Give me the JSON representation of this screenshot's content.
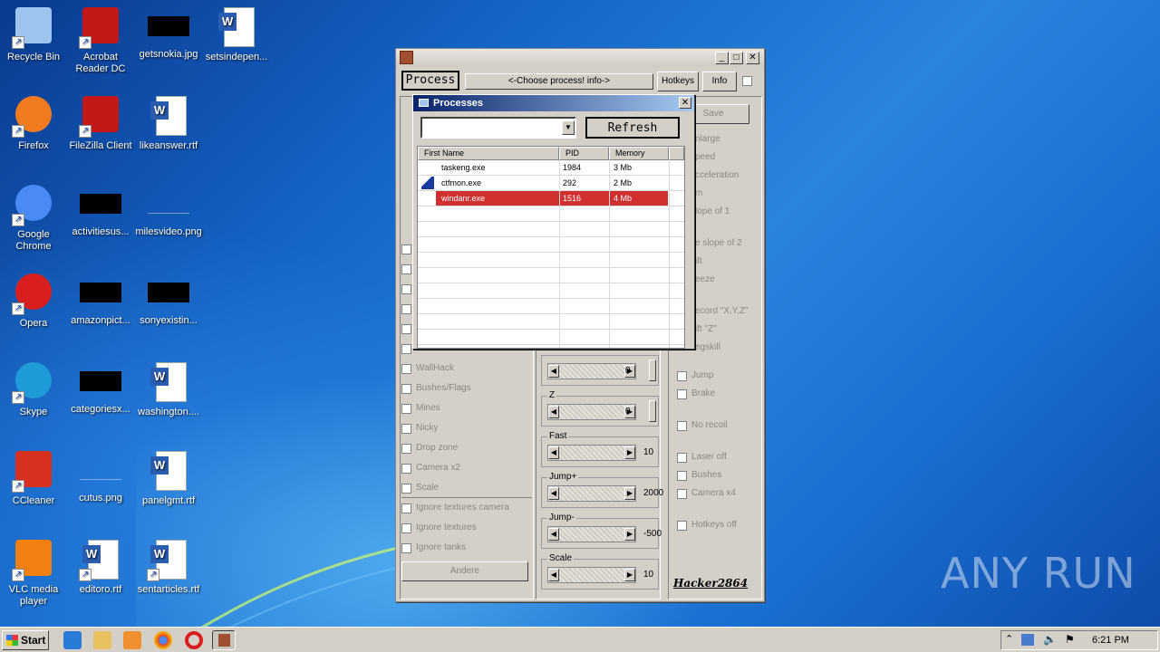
{
  "desktop": {
    "icons": [
      {
        "label": "Recycle Bin",
        "icon": "recycle-bin-icon"
      },
      {
        "label": "Acrobat Reader DC",
        "icon": "acrobat-icon"
      },
      {
        "label": "getsnokia.jpg",
        "icon": "image-thumb-icon"
      },
      {
        "label": "setsindepen...",
        "icon": "word-doc-icon"
      },
      {
        "label": "Firefox",
        "icon": "firefox-icon"
      },
      {
        "label": "FileZilla Client",
        "icon": "filezilla-icon"
      },
      {
        "label": "likeanswer.rtf",
        "icon": "word-doc-icon"
      },
      {
        "label": "Google Chrome",
        "icon": "chrome-icon"
      },
      {
        "label": "activitiesus...",
        "icon": "image-thumb-icon"
      },
      {
        "label": "milesvideo.png",
        "icon": "image-thumb-icon"
      },
      {
        "label": "Opera",
        "icon": "opera-icon"
      },
      {
        "label": "amazonpict...",
        "icon": "image-thumb-icon"
      },
      {
        "label": "sonyexistin...",
        "icon": "image-thumb-icon"
      },
      {
        "label": "Skype",
        "icon": "skype-icon"
      },
      {
        "label": "categoriesx...",
        "icon": "image-thumb-icon"
      },
      {
        "label": "washington....",
        "icon": "word-doc-icon"
      },
      {
        "label": "CCleaner",
        "icon": "ccleaner-icon"
      },
      {
        "label": "cutus.png",
        "icon": "image-thumb-icon"
      },
      {
        "label": "panelgmt.rtf",
        "icon": "word-doc-icon"
      },
      {
        "label": "VLC media player",
        "icon": "vlc-icon"
      },
      {
        "label": "editoro.rtf",
        "icon": "word-doc-icon"
      },
      {
        "label": "sentarticles.rtf",
        "icon": "word-doc-icon"
      }
    ]
  },
  "app": {
    "toolbar": {
      "process_label": "Process",
      "choose_label": "<-Choose process! info->",
      "hotkeys_label": "Hotkeys",
      "info_label": "Info"
    },
    "left_checks": [
      "WallHack",
      "Bushes/Flags",
      "Mines",
      "Nicky",
      "Drop zone",
      "Camera x2",
      "Scale",
      "Ignore textures camera",
      "Ignore textures",
      "Ignore tanks"
    ],
    "andere_label": "Andere",
    "right_partial": [
      "Save",
      "nlarge",
      "peed",
      "cceleration",
      "m",
      "lope of 1",
      "e slope of 2",
      "ift",
      "eeze",
      "ecord \"X,Y,Z\"",
      "ift \"Z\"",
      "egskill"
    ],
    "right_checks": [
      "Jump",
      "Brake",
      "No recoil",
      "Laser off",
      "Bushes",
      "Camera x4",
      "Hotkeys off"
    ],
    "sliders": [
      {
        "label": "",
        "value": "0"
      },
      {
        "label": "Z",
        "value": "0"
      },
      {
        "label": "Fast",
        "value": "10"
      },
      {
        "label": "Jump+",
        "value": "2000"
      },
      {
        "label": "Jump-",
        "value": "-500"
      },
      {
        "label": "Scale",
        "value": "10"
      }
    ],
    "signature": "Hacker2864"
  },
  "processes_dialog": {
    "title": "Processes",
    "refresh_label": "Refresh",
    "columns": [
      "First Name",
      "PID",
      "Memory"
    ],
    "rows": [
      {
        "name": "taskeng.exe",
        "pid": "1984",
        "memory": "3 Mb"
      },
      {
        "name": "ctfmon.exe",
        "pid": "292",
        "memory": "2 Mb"
      },
      {
        "name": "windanr.exe",
        "pid": "1516",
        "memory": "4 Mb"
      }
    ]
  },
  "taskbar": {
    "start_label": "Start",
    "clock": "6:21 PM"
  },
  "watermark": "ANY RUN"
}
